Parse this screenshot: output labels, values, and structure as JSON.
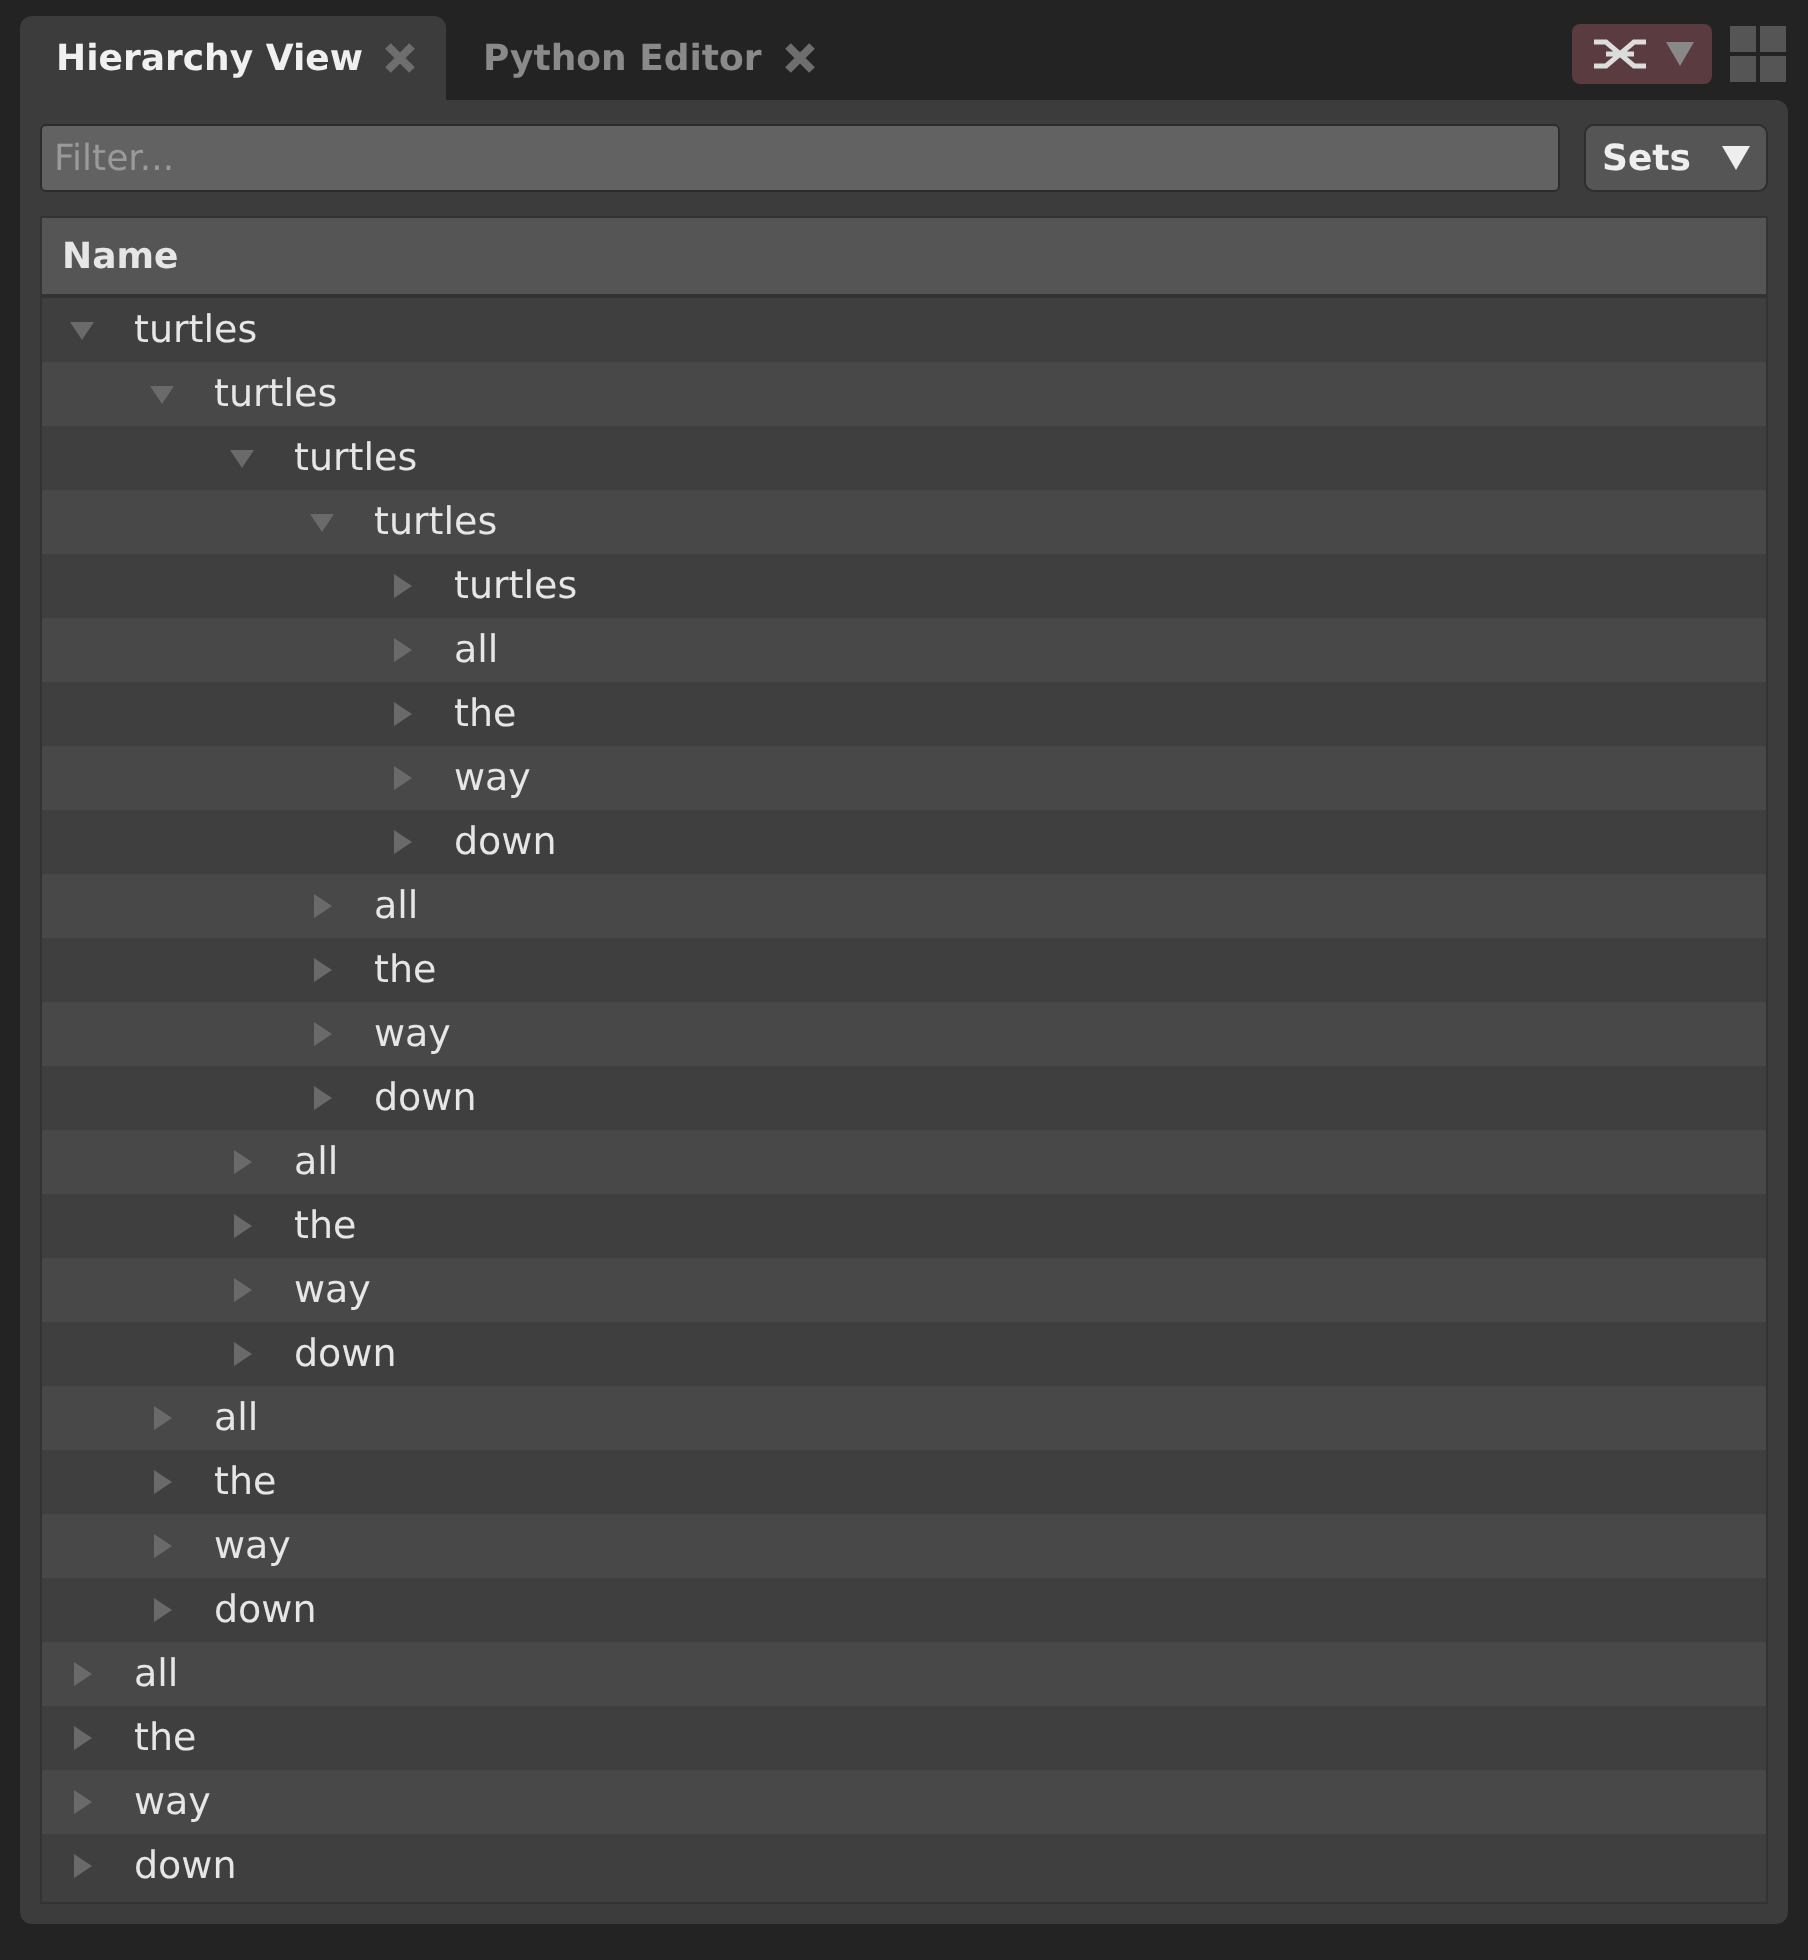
{
  "tabs": [
    {
      "label": "Hierarchy View",
      "selected": true
    },
    {
      "label": "Python Editor",
      "selected": false
    }
  ],
  "filter": {
    "placeholder": "Filter..."
  },
  "sets_button": {
    "label": "Sets"
  },
  "tree": {
    "columns": [
      "Name"
    ],
    "items": [
      {
        "label": "turtles",
        "expanded": true,
        "children": [
          {
            "label": "turtles",
            "expanded": true,
            "children": [
              {
                "label": "turtles",
                "expanded": true,
                "children": [
                  {
                    "label": "turtles",
                    "expanded": true,
                    "children": [
                      {
                        "label": "turtles",
                        "expanded": false
                      },
                      {
                        "label": "all",
                        "expanded": false
                      },
                      {
                        "label": "the",
                        "expanded": false
                      },
                      {
                        "label": "way",
                        "expanded": false
                      },
                      {
                        "label": "down",
                        "expanded": false
                      }
                    ]
                  },
                  {
                    "label": "all",
                    "expanded": false
                  },
                  {
                    "label": "the",
                    "expanded": false
                  },
                  {
                    "label": "way",
                    "expanded": false
                  },
                  {
                    "label": "down",
                    "expanded": false
                  }
                ]
              },
              {
                "label": "all",
                "expanded": false
              },
              {
                "label": "the",
                "expanded": false
              },
              {
                "label": "way",
                "expanded": false
              },
              {
                "label": "down",
                "expanded": false
              }
            ]
          },
          {
            "label": "all",
            "expanded": false
          },
          {
            "label": "the",
            "expanded": false
          },
          {
            "label": "way",
            "expanded": false
          },
          {
            "label": "down",
            "expanded": false
          }
        ]
      },
      {
        "label": "all",
        "expanded": false
      },
      {
        "label": "the",
        "expanded": false
      },
      {
        "label": "way",
        "expanded": false
      },
      {
        "label": "down",
        "expanded": false
      }
    ]
  }
}
